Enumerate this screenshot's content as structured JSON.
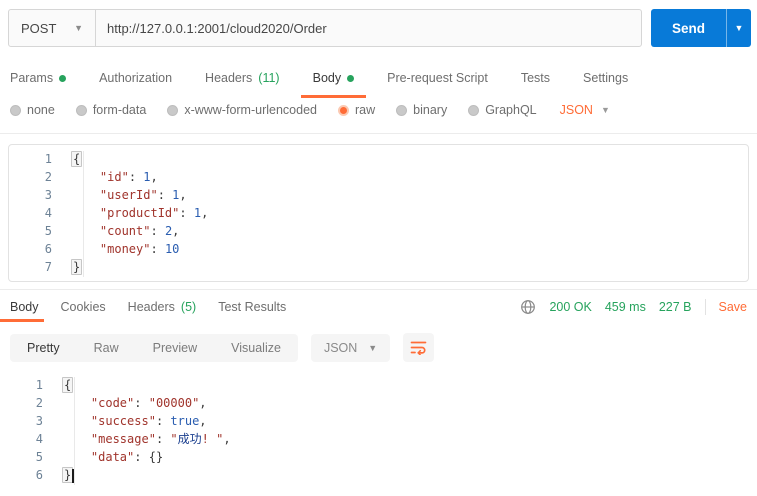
{
  "colors": {
    "accent_orange": "#ff6c37",
    "status_green": "#27a35d",
    "send_blue": "#087ad8",
    "code_key": "#a0342c",
    "code_value": "#2a5db0"
  },
  "request_bar": {
    "method": "POST",
    "url": "http://127.0.0.1:2001/cloud2020/Order",
    "send_label": "Send"
  },
  "request_tabs": {
    "items": [
      {
        "label": "Params"
      },
      {
        "label": "Authorization"
      },
      {
        "label": "Headers",
        "count": "(11)"
      },
      {
        "label": "Body"
      },
      {
        "label": "Pre-request Script"
      },
      {
        "label": "Tests"
      },
      {
        "label": "Settings"
      }
    ]
  },
  "body_type": {
    "options": [
      {
        "label": "none"
      },
      {
        "label": "form-data"
      },
      {
        "label": "x-www-form-urlencoded"
      },
      {
        "label": "raw"
      },
      {
        "label": "binary"
      },
      {
        "label": "GraphQL"
      }
    ],
    "language": "JSON"
  },
  "request_editor": {
    "lines": [
      {
        "n": "1",
        "toks": [
          [
            "brk",
            "{"
          ]
        ]
      },
      {
        "n": "2",
        "toks": [
          [
            "pun",
            "    "
          ],
          [
            "key",
            "\"id\""
          ],
          [
            "pun",
            ": "
          ],
          [
            "num",
            "1"
          ],
          [
            "pun",
            ","
          ]
        ]
      },
      {
        "n": "3",
        "toks": [
          [
            "pun",
            "    "
          ],
          [
            "key",
            "\"userId\""
          ],
          [
            "pun",
            ": "
          ],
          [
            "num",
            "1"
          ],
          [
            "pun",
            ","
          ]
        ]
      },
      {
        "n": "4",
        "toks": [
          [
            "pun",
            "    "
          ],
          [
            "key",
            "\"productId\""
          ],
          [
            "pun",
            ": "
          ],
          [
            "num",
            "1"
          ],
          [
            "pun",
            ","
          ]
        ]
      },
      {
        "n": "5",
        "toks": [
          [
            "pun",
            "    "
          ],
          [
            "key",
            "\"count\""
          ],
          [
            "pun",
            ": "
          ],
          [
            "num",
            "2"
          ],
          [
            "pun",
            ","
          ]
        ]
      },
      {
        "n": "6",
        "toks": [
          [
            "pun",
            "    "
          ],
          [
            "key",
            "\"money\""
          ],
          [
            "pun",
            ": "
          ],
          [
            "num",
            "10"
          ]
        ]
      },
      {
        "n": "7",
        "toks": [
          [
            "brk",
            "}"
          ]
        ]
      }
    ]
  },
  "response_bar": {
    "tabs": [
      {
        "label": "Body"
      },
      {
        "label": "Cookies"
      },
      {
        "label": "Headers",
        "count": "(5)"
      },
      {
        "label": "Test Results"
      }
    ],
    "status": "200 OK",
    "time": "459 ms",
    "size": "227 B",
    "save_label": "Save"
  },
  "response_toolbar": {
    "views": [
      {
        "label": "Pretty"
      },
      {
        "label": "Raw"
      },
      {
        "label": "Preview"
      },
      {
        "label": "Visualize"
      }
    ],
    "language": "JSON"
  },
  "response_editor": {
    "lines": [
      {
        "n": "1",
        "toks": [
          [
            "brk",
            "{"
          ]
        ]
      },
      {
        "n": "2",
        "toks": [
          [
            "pun",
            "    "
          ],
          [
            "key",
            "\"code\""
          ],
          [
            "pun",
            ": "
          ],
          [
            "str",
            "\"00000\""
          ],
          [
            "pun",
            ","
          ]
        ]
      },
      {
        "n": "3",
        "toks": [
          [
            "pun",
            "    "
          ],
          [
            "key",
            "\"success\""
          ],
          [
            "pun",
            ": "
          ],
          [
            "bool",
            "true"
          ],
          [
            "pun",
            ","
          ]
        ]
      },
      {
        "n": "4",
        "toks": [
          [
            "pun",
            "    "
          ],
          [
            "key",
            "\"message\""
          ],
          [
            "pun",
            ": "
          ],
          [
            "str",
            "\""
          ],
          [
            "cjk",
            "成功"
          ],
          [
            "str",
            "! \""
          ],
          [
            "pun",
            ","
          ]
        ]
      },
      {
        "n": "5",
        "toks": [
          [
            "pun",
            "    "
          ],
          [
            "key",
            "\"data\""
          ],
          [
            "pun",
            ": "
          ],
          [
            "pun",
            "{}"
          ]
        ]
      },
      {
        "n": "6",
        "toks": [
          [
            "brk",
            "}"
          ]
        ],
        "cursor": true
      }
    ]
  }
}
